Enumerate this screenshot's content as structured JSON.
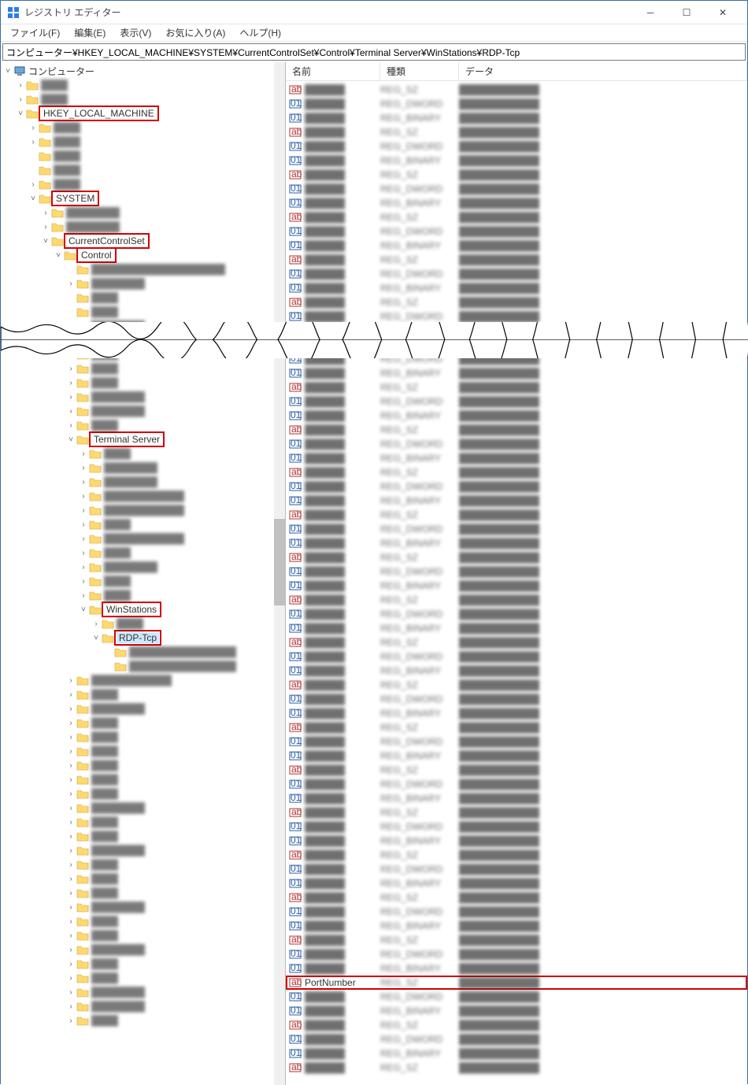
{
  "window": {
    "title": "レジストリ エディター"
  },
  "menu": {
    "file": "ファイル(F)",
    "edit": "編集(E)",
    "view": "表示(V)",
    "fav": "お気に入り(A)",
    "help": "ヘルプ(H)"
  },
  "address": "コンピューター¥HKEY_LOCAL_MACHINE¥SYSTEM¥CurrentControlSet¥Control¥Terminal Server¥WinStations¥RDP-Tcp",
  "cols": {
    "name": "名前",
    "type": "種類",
    "data": "データ"
  },
  "tree": {
    "root": "コンピューター",
    "hklm": "HKEY_LOCAL_MACHINE",
    "system": "SYSTEM",
    "ccs": "CurrentControlSet",
    "control": "Control",
    "ts": "Terminal Server",
    "ws": "WinStations",
    "rdp": "RDP-Tcp"
  },
  "highlight_value": "PortNumber",
  "blurred_labels": [
    "",
    "",
    "",
    "",
    "",
    "",
    "",
    "",
    "",
    "",
    "",
    "",
    "",
    "",
    "",
    "",
    "",
    "",
    "",
    "",
    "",
    "",
    "",
    "",
    "",
    "",
    "",
    "",
    "",
    "",
    "",
    "",
    "",
    "",
    "",
    "",
    "",
    "",
    "",
    "",
    "",
    "",
    "",
    "",
    "",
    "",
    "",
    "",
    "",
    "",
    ""
  ]
}
